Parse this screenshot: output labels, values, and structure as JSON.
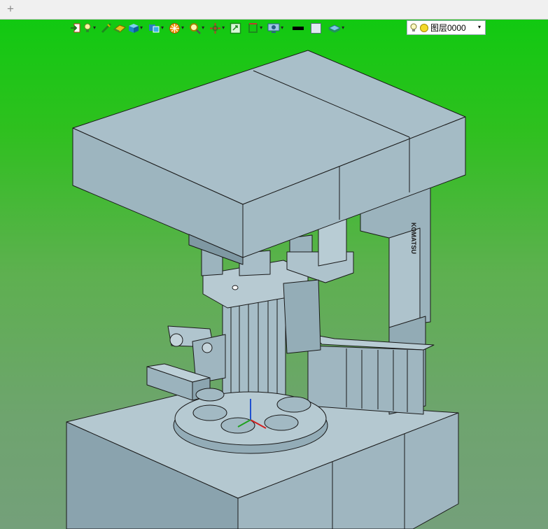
{
  "tabs": {
    "new_tab_label": "+"
  },
  "toolbar": {
    "buttons": [
      "import-icon",
      "light-bulb-icon",
      "line-icon",
      "face-icon",
      "solid-box-icon",
      "view-cube-icon",
      "render-sphere-icon",
      "zoom-icon",
      "pan-icon",
      "fit-view-icon",
      "section-icon",
      "monitor-icon",
      "layer-stack-icon"
    ],
    "line_color": "#000000",
    "fill_color": "#dfe9f0",
    "layer": {
      "label": "图层0000",
      "color": "#f5d92a"
    }
  },
  "viewport": {
    "background_top": "#11c911",
    "background_bottom": "#74a07a",
    "model_face_color": "#a4bcc6",
    "model_edge_color": "#1a1a1a",
    "nameplate_text": "KOMATSU"
  }
}
